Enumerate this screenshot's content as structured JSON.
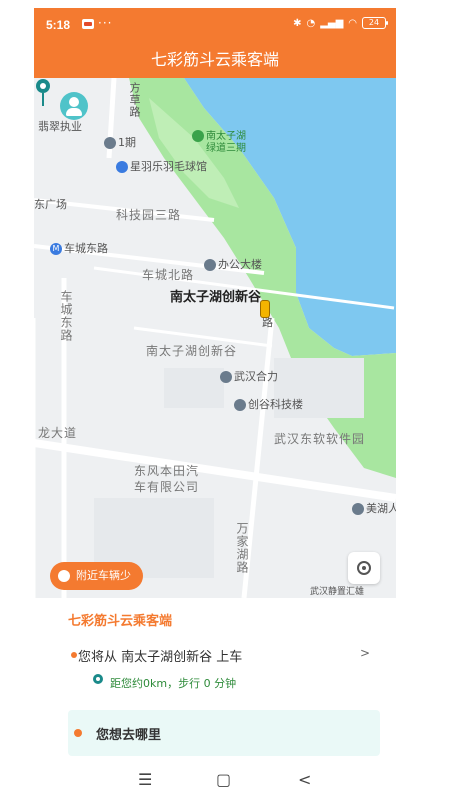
{
  "status_bar": {
    "time": "5:18",
    "more": "···",
    "battery": "24"
  },
  "header": {
    "title": "七彩筋斗云乘客端"
  },
  "map": {
    "labels": {
      "road_fangcao": "方草路",
      "feicui": "翡翠执业",
      "dongtai_1": "1期",
      "badminton": "星羽乐羽毛球馆",
      "park_line1": "南太子湖",
      "park_line2": "绿道三期",
      "square": "东广场",
      "keji3": "科技园三路",
      "metro": "车城东路",
      "office": "办公大楼",
      "chengbei": "车城北路",
      "destination": "南太子湖创新谷",
      "road_jin": "路",
      "chengdong": "车城东路",
      "nanbig": "南太子湖创新谷",
      "wuhanhe": "武汉合力",
      "chuanggu": "创谷科技楼",
      "dalong": "龙大道",
      "ruanjian": "武汉东软软件园",
      "dongfeng1": "东风本田汽",
      "dongfeng2": "车有限公司",
      "yuanjia": "万家湖路",
      "meihu": "美湖人",
      "bottom_right": "武汉静置汇雄"
    }
  },
  "nearby_button": "附近车辆少",
  "panel": {
    "title": "七彩筋斗云乘客端",
    "pickup": "您将从 南太子湖创新谷 上车",
    "chevron": ">",
    "walk": "距您约0km，步行 0 分钟",
    "destination_prompt": "您想去哪里"
  },
  "nav": {
    "menu": "☰",
    "home": "▢",
    "back": "<"
  },
  "colors": {
    "accent": "#f47a30",
    "water": "#7ec8f0",
    "park": "#a8e6a0",
    "dest_bg": "#eaf9f7"
  }
}
